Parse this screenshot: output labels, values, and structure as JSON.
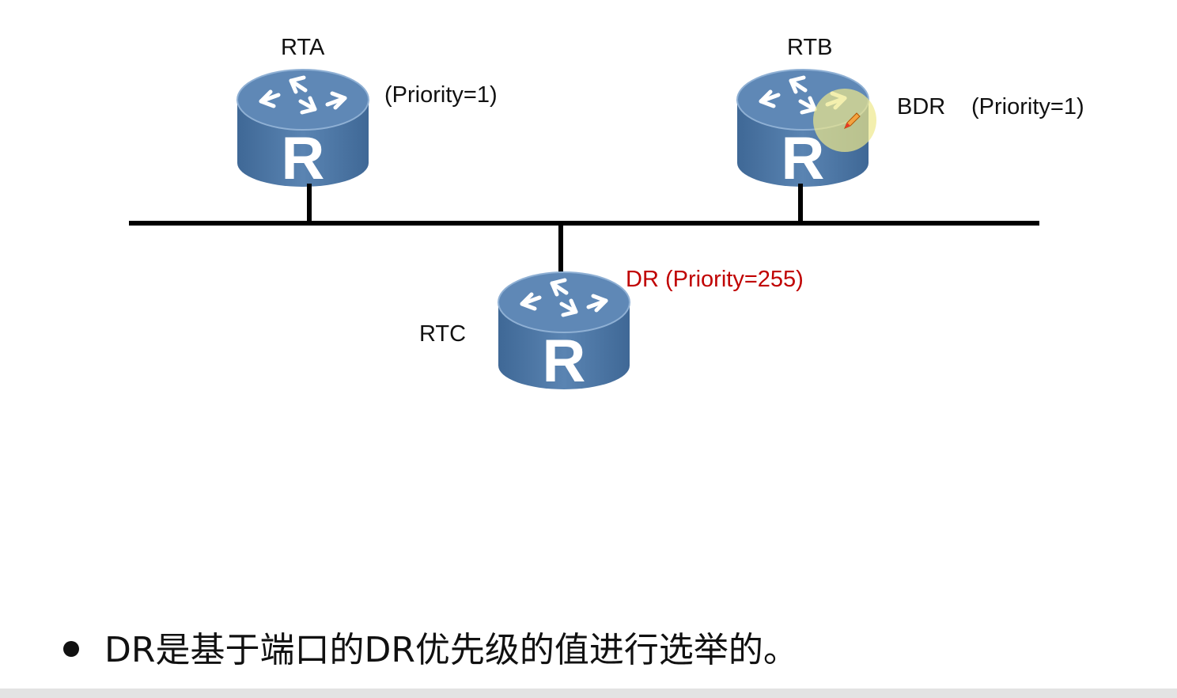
{
  "routers": [
    {
      "id": "rta",
      "name": "RTA",
      "info": "(Priority=1)",
      "role": "",
      "glyph": "R"
    },
    {
      "id": "rtb",
      "name": "RTB",
      "info": "(Priority=1)",
      "role": "BDR",
      "glyph": "R"
    },
    {
      "id": "rtc",
      "name": "RTC",
      "info": "DR (Priority=255)",
      "role": "DR",
      "glyph": "R"
    }
  ],
  "note": "DR是基于端口的DR优先级的值进行选举的。",
  "colors": {
    "router_body": "#4f79a8",
    "router_top": "#6d95c2",
    "dr_label": "#c00000",
    "link": "#000000",
    "cursor_highlight": "#eee88c"
  },
  "icons": {
    "router": "router-icon",
    "cursor": "pen-cursor-icon"
  }
}
